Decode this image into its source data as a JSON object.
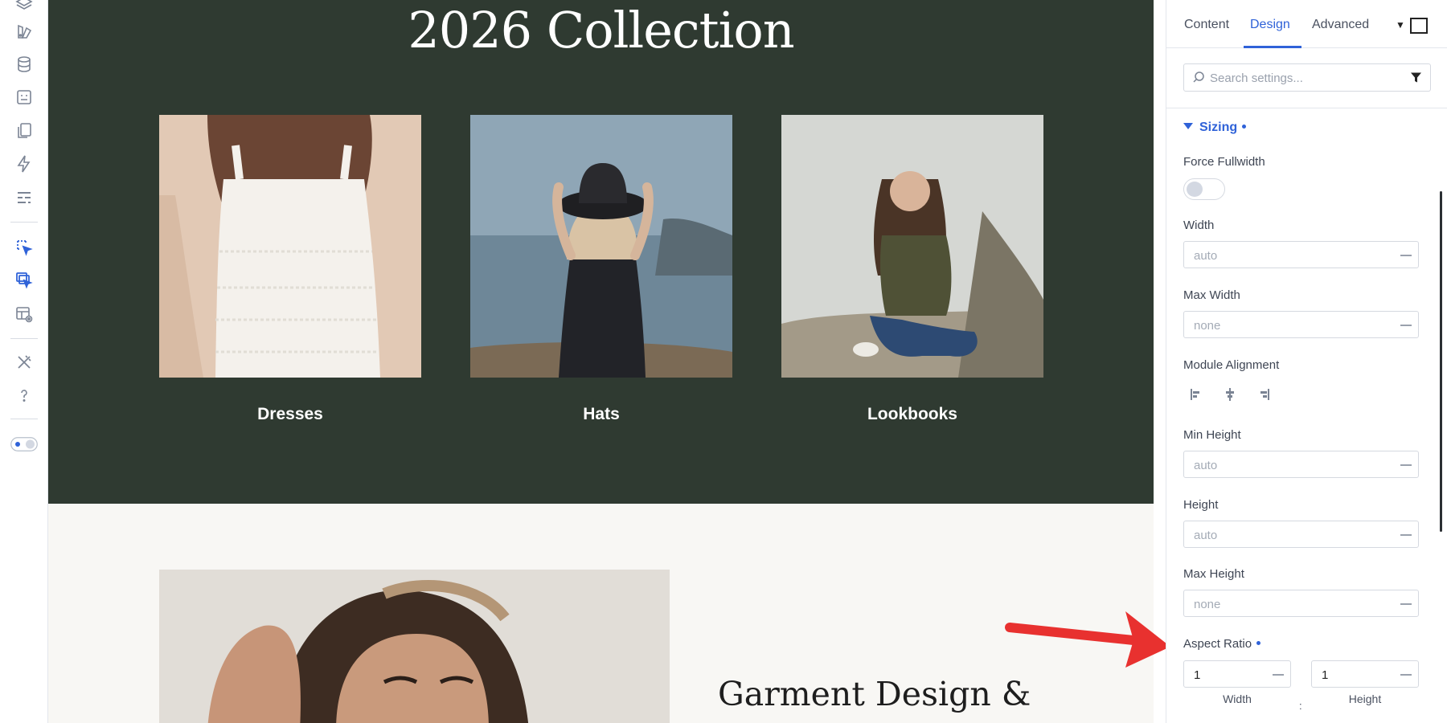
{
  "canvas": {
    "hero_title": "2026 Collection",
    "categories": [
      {
        "label": "Dresses"
      },
      {
        "label": "Hats"
      },
      {
        "label": "Lookbooks"
      }
    ],
    "section2_heading": "Garment Design &"
  },
  "panel": {
    "tabs": [
      {
        "label": "Content",
        "active": false
      },
      {
        "label": "Design",
        "active": true
      },
      {
        "label": "Advanced",
        "active": false
      }
    ],
    "search_placeholder": "Search settings...",
    "section_title": "Sizing",
    "fields": {
      "force_fullwidth": {
        "label": "Force Fullwidth",
        "enabled": false
      },
      "width": {
        "label": "Width",
        "placeholder": "auto"
      },
      "max_width": {
        "label": "Max Width",
        "placeholder": "none"
      },
      "module_alignment": {
        "label": "Module Alignment"
      },
      "min_height": {
        "label": "Min Height",
        "placeholder": "auto"
      },
      "height": {
        "label": "Height",
        "placeholder": "auto"
      },
      "max_height": {
        "label": "Max Height",
        "placeholder": "none"
      },
      "aspect_ratio": {
        "label": "Aspect Ratio",
        "width_value": "1",
        "height_value": "1",
        "width_label": "Width",
        "height_label": "Height",
        "separator": ":"
      }
    }
  },
  "colors": {
    "hero_bg": "#2f3a31",
    "section2_bg": "#f8f7f4",
    "accent": "#2f62d8",
    "arrow": "#e8312f"
  }
}
